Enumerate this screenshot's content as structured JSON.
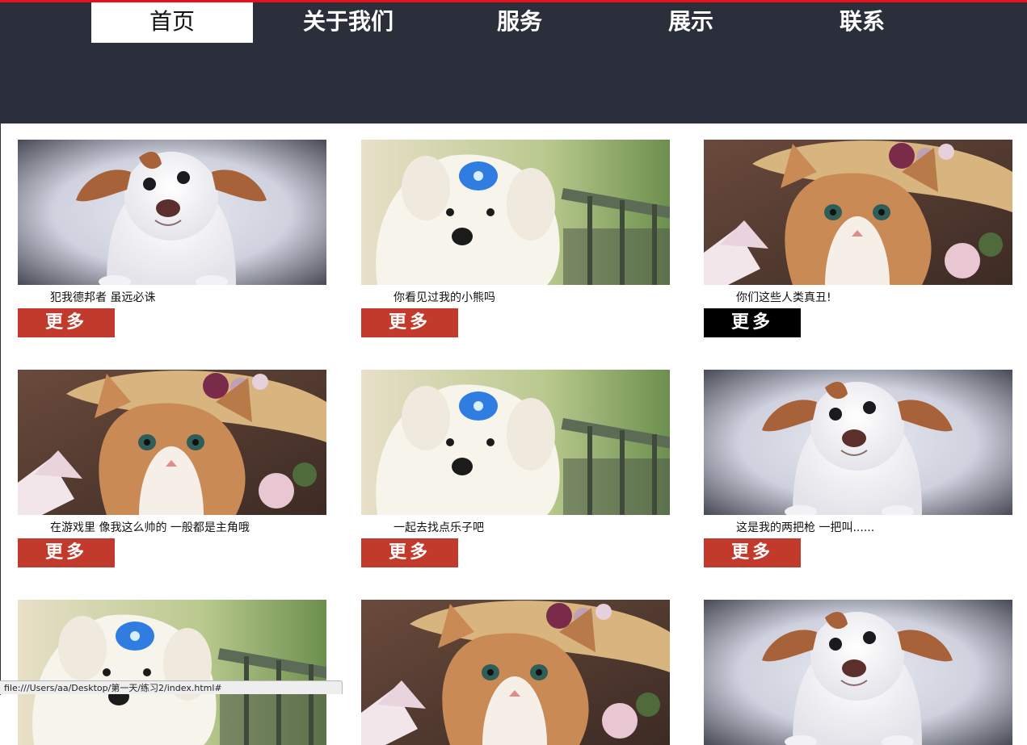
{
  "nav": {
    "items": [
      {
        "label": "首页"
      },
      {
        "label": "关于我们"
      },
      {
        "label": "服务"
      },
      {
        "label": "展示"
      },
      {
        "label": "联系"
      }
    ]
  },
  "cards": [
    {
      "image": "white-dog-photo",
      "caption": "犯我德邦者 虽远必诛",
      "more": "更多"
    },
    {
      "image": "white-puppy-photo",
      "caption": "你看见过我的小熊吗",
      "more": "更多"
    },
    {
      "image": "kitten-hat-photo",
      "caption": "你们这些人类真丑!",
      "more": "更多"
    },
    {
      "image": "kitten-hat-photo",
      "caption": "在游戏里 像我这么帅的 一般都是主角哦",
      "more": "更多"
    },
    {
      "image": "white-puppy-photo",
      "caption": "一起去找点乐子吧",
      "more": "更多"
    },
    {
      "image": "white-dog-photo",
      "caption": "这是我的两把枪 一把叫......",
      "more": "更多"
    },
    {
      "image": "white-puppy-photo"
    },
    {
      "image": "kitten-hat-photo"
    },
    {
      "image": "white-dog-photo"
    }
  ],
  "colors": {
    "header": "#2b2f3b",
    "accent": "#e8101b",
    "button": "#c23a2b",
    "button_active": "#000000"
  },
  "status_bar": {
    "url": "file:///Users/aa/Desktop/第一天/练习2/index.html#"
  }
}
